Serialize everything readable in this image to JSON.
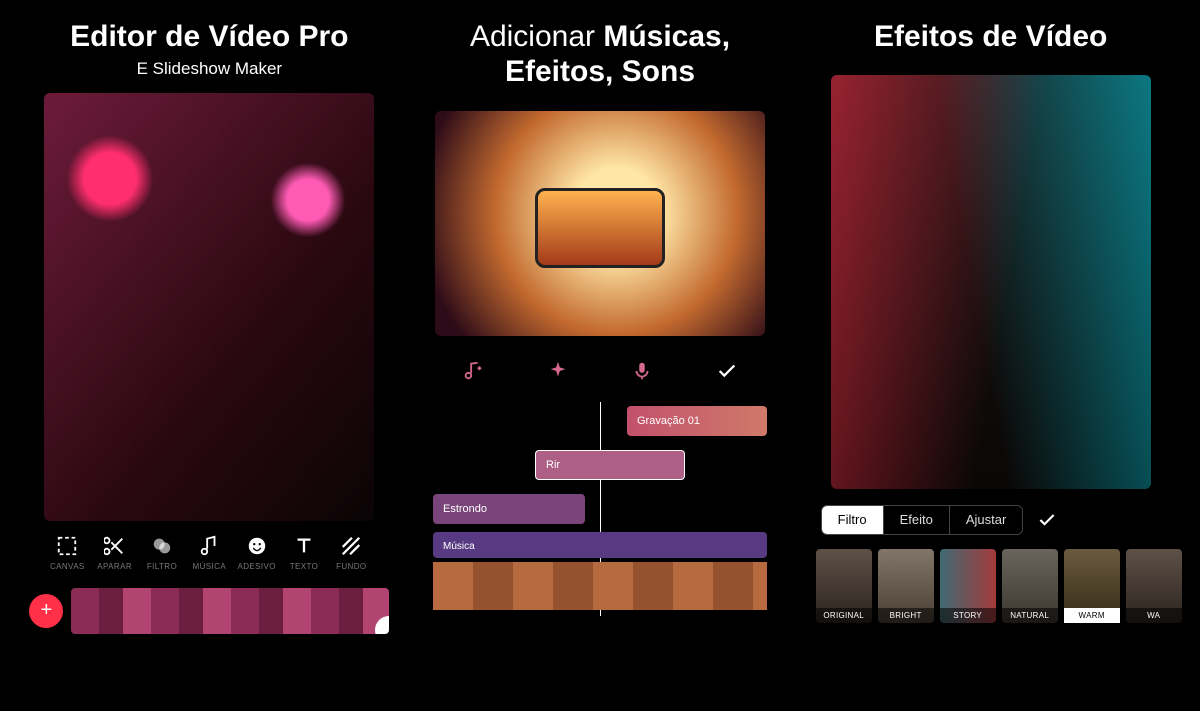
{
  "panel1": {
    "title": "Editor de Vídeo Pro",
    "subtitle": "E Slideshow Maker",
    "tools": [
      {
        "name": "canvas",
        "label": "CANVAS"
      },
      {
        "name": "trim",
        "label": "APARAR"
      },
      {
        "name": "filter",
        "label": "FILTRO"
      },
      {
        "name": "music",
        "label": "MÚSICA"
      },
      {
        "name": "sticker",
        "label": "ADESIVO"
      },
      {
        "name": "text",
        "label": "TEXTO"
      },
      {
        "name": "bg",
        "label": "FUNDO"
      }
    ],
    "add_label": "+"
  },
  "panel2": {
    "title_light": "Adicionar ",
    "title_bold": "Músicas, Efeitos, Sons",
    "icons": [
      "music-add",
      "sparkle",
      "mic",
      "check"
    ],
    "tracks": {
      "t1": "Gravação 01",
      "t2": "Rir",
      "t3": "Estrondo",
      "t4": "Música"
    }
  },
  "panel3": {
    "title": "Efeitos de Vídeo",
    "segments": [
      {
        "name": "filtro",
        "label": "Filtro",
        "selected": true
      },
      {
        "name": "efeito",
        "label": "Efeito",
        "selected": false
      },
      {
        "name": "ajustar",
        "label": "Ajustar",
        "selected": false
      }
    ],
    "presets": [
      {
        "name": "original",
        "label": "ORIGINAL",
        "selected": false
      },
      {
        "name": "bright",
        "label": "BRIGHT",
        "selected": false
      },
      {
        "name": "story",
        "label": "STORY",
        "selected": false
      },
      {
        "name": "natural",
        "label": "NATURAL",
        "selected": false
      },
      {
        "name": "warm",
        "label": "WARM",
        "selected": true
      },
      {
        "name": "wa",
        "label": "WA",
        "selected": false
      }
    ]
  }
}
